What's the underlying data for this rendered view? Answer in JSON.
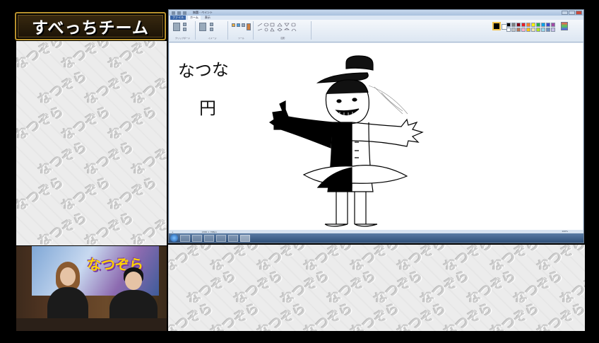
{
  "team_banner": {
    "text": "すべっちチーム"
  },
  "watermark": {
    "text": "なつぞら",
    "count_left": 20,
    "count_bottom": 18
  },
  "paint": {
    "title": "無題 - ペイント",
    "menu": [
      {
        "label": "ファイル"
      },
      {
        "label": "ホーム"
      },
      {
        "label": "表示"
      }
    ],
    "ribbon_groups": [
      "クリップボード",
      "イメージ",
      "ツール",
      "図形",
      "色"
    ],
    "current_color": "#000000",
    "palette": [
      "#000000",
      "#7f7f7f",
      "#880015",
      "#ed1c24",
      "#ff7f27",
      "#fff200",
      "#22b14c",
      "#00a2e8",
      "#3f48cc",
      "#a349a4",
      "#ffffff",
      "#c3c3c3",
      "#b97a57",
      "#ffaec9",
      "#ffc90e",
      "#efe4b0",
      "#b5e61d",
      "#99d9ea",
      "#7092be",
      "#c8bfe7"
    ],
    "status": {
      "size": "1366 × 768px",
      "zoom": "100%"
    },
    "drawing_text": [
      "なつな",
      "円"
    ]
  },
  "taskbar": {
    "clock": ""
  },
  "webcam": {
    "logo": "なつぞら"
  }
}
